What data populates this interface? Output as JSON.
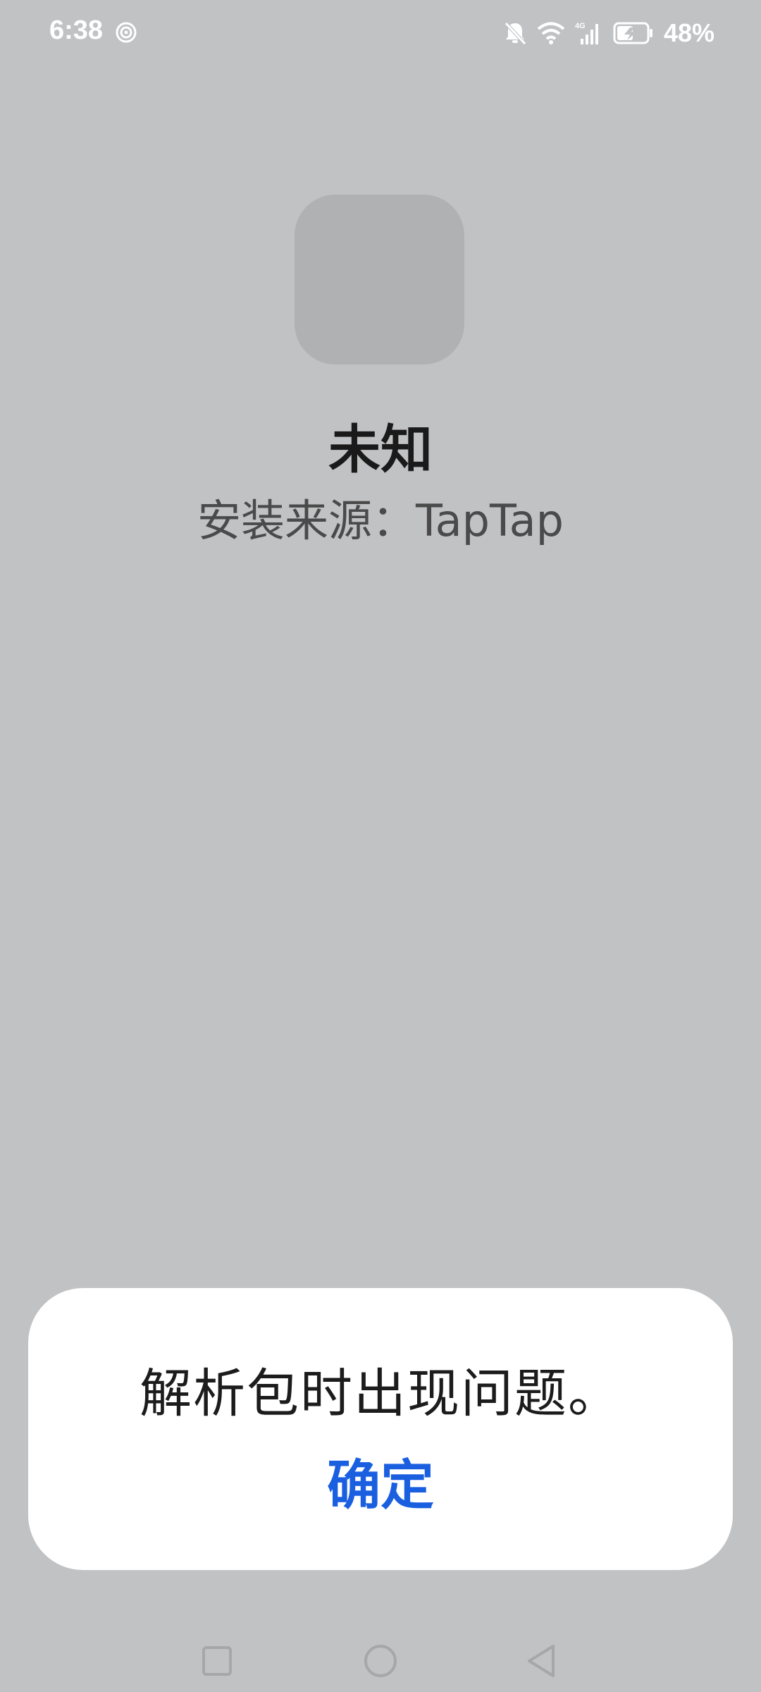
{
  "status_bar": {
    "time": "6:38",
    "battery_percent": "48%",
    "icons": [
      "hotspot-icon",
      "mute-bell-icon",
      "wifi-icon",
      "4g-signal-icon",
      "battery-charging-icon"
    ]
  },
  "app": {
    "name": "未知",
    "install_source": "安装来源：TapTap"
  },
  "dialog": {
    "message": "解析包时出现问题。",
    "confirm_label": "确定",
    "accent_color": "#1a5fe0"
  },
  "nav_bar": {
    "buttons": [
      "recent-apps",
      "home",
      "back"
    ]
  }
}
